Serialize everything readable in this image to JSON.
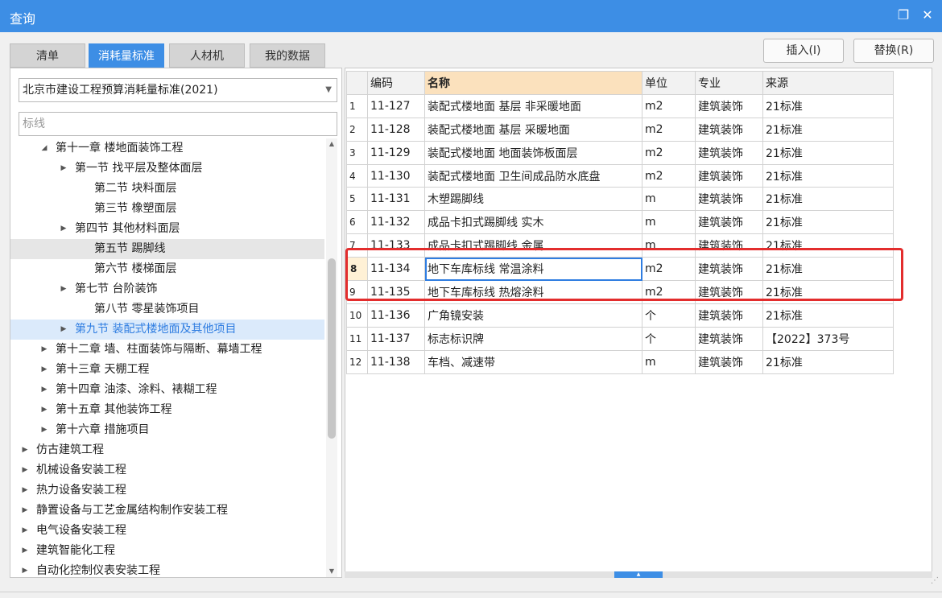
{
  "window": {
    "title": "查询",
    "restore_glyph": "❐",
    "close_glyph": "✕"
  },
  "tabs": [
    {
      "label": "清单"
    },
    {
      "label": "消耗量标准"
    },
    {
      "label": "人材机"
    },
    {
      "label": "我的数据"
    }
  ],
  "buttons": {
    "insert": "插入(I)",
    "replace": "替换(R)"
  },
  "left": {
    "selected_standard": "北京市建设工程预算消耗量标准(2021)",
    "search_placeholder": "标线",
    "tree": [
      {
        "label": "第十一章 楼地面装饰工程",
        "arrow": "◢"
      },
      {
        "label": "第一节 找平层及整体面层",
        "arrow": "▶"
      },
      {
        "label": "第二节 块料面层",
        "arrow": ""
      },
      {
        "label": "第三节 橡塑面层",
        "arrow": ""
      },
      {
        "label": "第四节 其他材料面层",
        "arrow": "▶"
      },
      {
        "label": "第五节 踢脚线",
        "arrow": ""
      },
      {
        "label": "第六节 楼梯面层",
        "arrow": ""
      },
      {
        "label": "第七节 台阶装饰",
        "arrow": "▶"
      },
      {
        "label": "第八节 零星装饰项目",
        "arrow": ""
      },
      {
        "label": "第九节 装配式楼地面及其他项目",
        "arrow": "▶"
      },
      {
        "label": "第十二章 墙、柱面装饰与隔断、幕墙工程",
        "arrow": "▶"
      },
      {
        "label": "第十三章 天棚工程",
        "arrow": "▶"
      },
      {
        "label": "第十四章 油漆、涂料、裱糊工程",
        "arrow": "▶"
      },
      {
        "label": "第十五章 其他装饰工程",
        "arrow": "▶"
      },
      {
        "label": "第十六章 措施项目",
        "arrow": "▶"
      },
      {
        "label": "仿古建筑工程",
        "arrow": "▶"
      },
      {
        "label": "机械设备安装工程",
        "arrow": "▶"
      },
      {
        "label": "热力设备安装工程",
        "arrow": "▶"
      },
      {
        "label": "静置设备与工艺金属结构制作安装工程",
        "arrow": "▶"
      },
      {
        "label": "电气设备安装工程",
        "arrow": "▶"
      },
      {
        "label": "建筑智能化工程",
        "arrow": "▶"
      },
      {
        "label": "自动化控制仪表安装工程",
        "arrow": "▶"
      }
    ]
  },
  "grid": {
    "columns": [
      "",
      "编码",
      "名称",
      "单位",
      "专业",
      "来源"
    ],
    "rows": [
      [
        "1",
        "11-127",
        "装配式楼地面 基层 非采暖地面",
        "m2",
        "建筑装饰",
        "21标准"
      ],
      [
        "2",
        "11-128",
        "装配式楼地面 基层 采暖地面",
        "m2",
        "建筑装饰",
        "21标准"
      ],
      [
        "3",
        "11-129",
        "装配式楼地面 地面装饰板面层",
        "m2",
        "建筑装饰",
        "21标准"
      ],
      [
        "4",
        "11-130",
        "装配式楼地面 卫生间成品防水底盘",
        "m2",
        "建筑装饰",
        "21标准"
      ],
      [
        "5",
        "11-131",
        "木塑踢脚线",
        "m",
        "建筑装饰",
        "21标准"
      ],
      [
        "6",
        "11-132",
        "成品卡扣式踢脚线 实木",
        "m",
        "建筑装饰",
        "21标准"
      ],
      [
        "7",
        "11-133",
        "成品卡扣式踢脚线 金属",
        "m",
        "建筑装饰",
        "21标准"
      ],
      [
        "8",
        "11-134",
        "地下车库标线 常温涂料",
        "m2",
        "建筑装饰",
        "21标准"
      ],
      [
        "9",
        "11-135",
        "地下车库标线 热熔涂料",
        "m2",
        "建筑装饰",
        "21标准"
      ],
      [
        "10",
        "11-136",
        "广角镜安装",
        "个",
        "建筑装饰",
        "21标准"
      ],
      [
        "11",
        "11-137",
        "标志标识牌",
        "个",
        "建筑装饰",
        "【2022】373号"
      ],
      [
        "12",
        "11-138",
        "车档、减速带",
        "m",
        "建筑装饰",
        "21标准"
      ]
    ]
  }
}
